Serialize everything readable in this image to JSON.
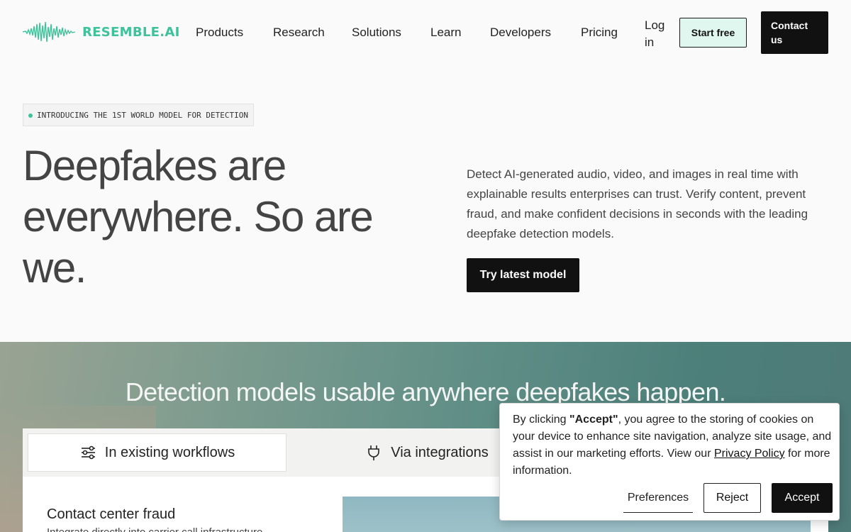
{
  "brand": {
    "name": "RESEMBLE.AI",
    "accent": "#3ec29a"
  },
  "nav": {
    "items": [
      "Products",
      "Research",
      "Solutions",
      "Learn",
      "Developers",
      "Pricing"
    ],
    "login": "Log in",
    "start_free": "Start free",
    "contact": "Contact us"
  },
  "hero": {
    "badge": "INTRODUCING THE 1ST WORLD MODEL FOR DETECTION",
    "title": "Deepfakes are everywhere. So are we.",
    "description": "Detect AI-generated audio, video, and images in real time with explainable results enterprises can trust. Verify content, prevent fraud, and make confident decisions in seconds with the leading deepfake detection models.",
    "cta": "Try latest model"
  },
  "section": {
    "title": "Detection models usable anywhere deepfakes happen.",
    "tabs": [
      {
        "label": "In existing workflows",
        "icon": "sliders-icon"
      },
      {
        "label": "Via integrations",
        "icon": "plug-icon"
      }
    ],
    "card": {
      "title": "Contact center fraud",
      "description": "Integrate directly into carrier call infrastructure"
    }
  },
  "cookie": {
    "text_before": "By clicking ",
    "accept_word": "\"Accept\"",
    "text_middle": ", you agree to the storing of cookies on your device to enhance site navigation, analyze site usage, and assist in our marketing efforts. View our ",
    "privacy_link": "Privacy Policy",
    "text_after": " for more information.",
    "preferences": "Preferences",
    "reject": "Reject",
    "accept": "Accept"
  }
}
